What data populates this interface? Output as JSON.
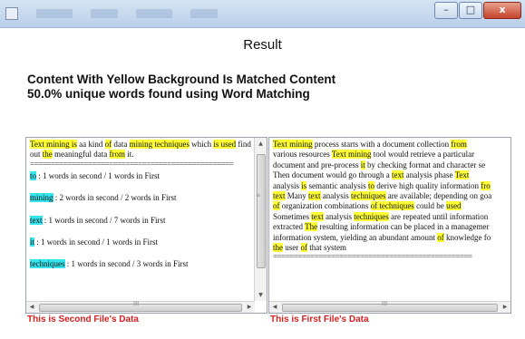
{
  "window": {
    "min_label": "–",
    "max_label": "□",
    "close_label": "x"
  },
  "header": {
    "title": "Result",
    "line1": "Content With Yellow Background Is Matched Content",
    "line2": "50.0% unique words found using Word Matching"
  },
  "second_file": {
    "text_segments": [
      {
        "t": "Text mining is",
        "hl": true
      },
      {
        "t": " aa kind ",
        "hl": false
      },
      {
        "t": "of",
        "hl": true
      },
      {
        "t": " data ",
        "hl": false
      },
      {
        "t": "mining techniques",
        "hl": true
      },
      {
        "t": " which ",
        "hl": false
      },
      {
        "t": "is used",
        "hl": true
      },
      {
        "t": " find out ",
        "hl": false
      },
      {
        "t": "the",
        "hl": true
      },
      {
        "t": " meaningful data ",
        "hl": false
      },
      {
        "t": "from",
        "hl": true
      },
      {
        "t": " it.",
        "hl": false
      }
    ],
    "separator": "=================================================",
    "matches": [
      {
        "word": "to",
        "desc": " : 1 words in second / 1 words in First"
      },
      {
        "word": "mining",
        "desc": " : 2 words in second / 2 words in First"
      },
      {
        "word": "text",
        "desc": " : 1 words in second / 7 words in First"
      },
      {
        "word": "it",
        "desc": " : 1 words in second / 1 words in First"
      },
      {
        "word": "techniques",
        "desc": " : 1 words in second / 3 words in First"
      }
    ],
    "caption": "This is Second File's Data"
  },
  "first_file": {
    "lines": [
      [
        {
          "t": "Text mining",
          "hl": true
        },
        {
          "t": " process starts with a document collection ",
          "hl": false
        },
        {
          "t": "from",
          "hl": true
        }
      ],
      [
        {
          "t": "various resources ",
          "hl": false
        },
        {
          "t": "Text mining",
          "hl": true
        },
        {
          "t": " tool would retrieve a particular",
          "hl": false
        }
      ],
      [
        {
          "t": "document and pre-process ",
          "hl": false
        },
        {
          "t": "it",
          "hl": true
        },
        {
          "t": " by checking format and character se",
          "hl": false
        }
      ],
      [
        {
          "t": "Then document would go through a ",
          "hl": false
        },
        {
          "t": "text",
          "hl": true
        },
        {
          "t": " analysis phase ",
          "hl": false
        },
        {
          "t": "Text",
          "hl": true
        }
      ],
      [
        {
          "t": "analysis ",
          "hl": false
        },
        {
          "t": "is",
          "hl": true
        },
        {
          "t": " semantic analysis ",
          "hl": false
        },
        {
          "t": "to",
          "hl": true
        },
        {
          "t": " derive high quality information ",
          "hl": false
        },
        {
          "t": "fro",
          "hl": true
        }
      ],
      [
        {
          "t": "text",
          "hl": true
        },
        {
          "t": " Many ",
          "hl": false
        },
        {
          "t": "text",
          "hl": true
        },
        {
          "t": " analysis ",
          "hl": false
        },
        {
          "t": "techniques",
          "hl": true
        },
        {
          "t": " are available; depending on goa",
          "hl": false
        }
      ],
      [
        {
          "t": "of",
          "hl": true
        },
        {
          "t": " organization combinations ",
          "hl": false
        },
        {
          "t": "of techniques",
          "hl": true
        },
        {
          "t": " could be ",
          "hl": false
        },
        {
          "t": "used",
          "hl": true
        }
      ],
      [
        {
          "t": "Sometimes ",
          "hl": false
        },
        {
          "t": "text",
          "hl": true
        },
        {
          "t": " analysis ",
          "hl": false
        },
        {
          "t": "techniques",
          "hl": true
        },
        {
          "t": " are repeated until information",
          "hl": false
        }
      ],
      [
        {
          "t": "extracted ",
          "hl": false
        },
        {
          "t": "The",
          "hl": true
        },
        {
          "t": " resulting information can be placed in a managemer",
          "hl": false
        }
      ],
      [
        {
          "t": "information system, yielding an abundant amount ",
          "hl": false
        },
        {
          "t": "of",
          "hl": true
        },
        {
          "t": " knowledge fo",
          "hl": false
        }
      ],
      [
        {
          "t": "the",
          "hl": true
        },
        {
          "t": " user ",
          "hl": false
        },
        {
          "t": "of",
          "hl": true
        },
        {
          "t": " that system",
          "hl": false
        }
      ]
    ],
    "separator": "================================================",
    "caption": "This is First File's Data"
  },
  "scroll": {
    "up": "▲",
    "down": "▼",
    "left": "◀",
    "right": "▶",
    "grip_v": "≡",
    "grip_h": "III"
  }
}
